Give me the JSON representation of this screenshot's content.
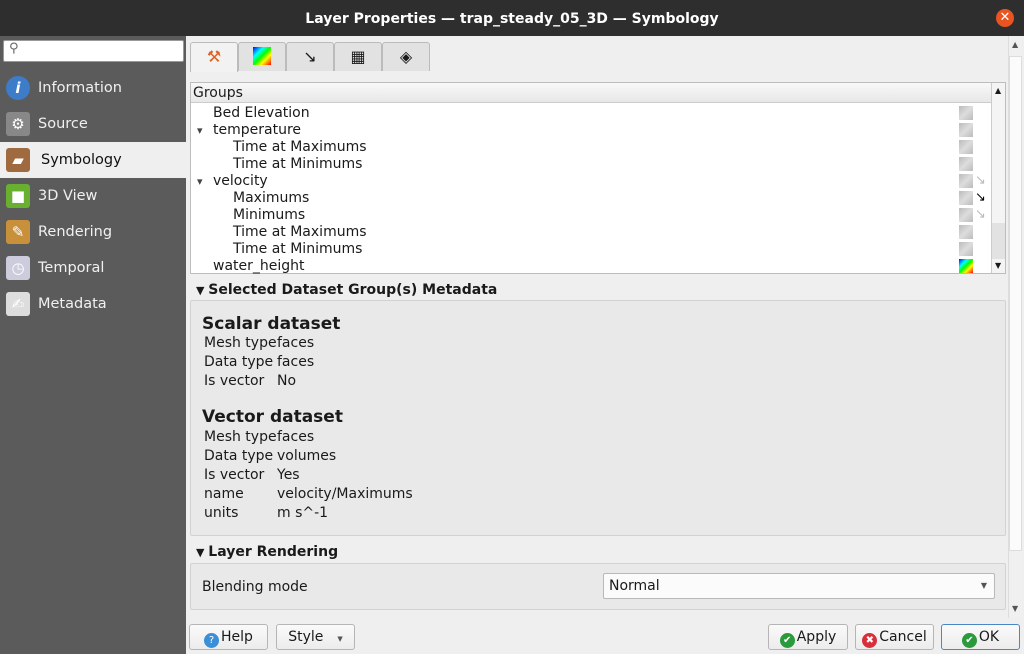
{
  "window": {
    "title": "Layer Properties — trap_steady_05_3D — Symbology",
    "close_icon": "close-icon",
    "accent": "#e95420"
  },
  "sidebar": {
    "search_placeholder": "",
    "items": [
      {
        "label": "Information",
        "icon": "info-icon"
      },
      {
        "label": "Source",
        "icon": "source-icon"
      },
      {
        "label": "Symbology",
        "icon": "symbology-icon",
        "selected": true
      },
      {
        "label": "3D View",
        "icon": "cube-icon"
      },
      {
        "label": "Rendering",
        "icon": "brush-icon"
      },
      {
        "label": "Temporal",
        "icon": "clock-icon"
      },
      {
        "label": "Metadata",
        "icon": "metadata-icon"
      }
    ]
  },
  "tabs": [
    {
      "icon": "tools-icon",
      "selected": true
    },
    {
      "icon": "color-ramp-icon"
    },
    {
      "icon": "vector-arrow-icon"
    },
    {
      "icon": "mesh-grid-icon"
    },
    {
      "icon": "stack-icon"
    }
  ],
  "groups": {
    "header": "Groups",
    "rows": [
      {
        "label": "Bed Elevation",
        "level": 0
      },
      {
        "label": "temperature",
        "level": 0,
        "expanded": true
      },
      {
        "label": "Time at Maximums",
        "level": 1
      },
      {
        "label": "Time at Minimums",
        "level": 1
      },
      {
        "label": "velocity",
        "level": 0,
        "expanded": true,
        "vector": "inactive"
      },
      {
        "label": "Maximums",
        "level": 1,
        "vector": "active"
      },
      {
        "label": "Minimums",
        "level": 1,
        "vector": "inactive"
      },
      {
        "label": "Time at Maximums",
        "level": 1
      },
      {
        "label": "Time at Minimums",
        "level": 1
      },
      {
        "label": "water_height",
        "level": 0,
        "scalar_active": true
      }
    ]
  },
  "metadata": {
    "title": "Selected Dataset Group(s) Metadata",
    "scalar": {
      "title": "Scalar dataset",
      "fields": [
        [
          "Mesh type",
          "faces"
        ],
        [
          "Data type",
          "faces"
        ],
        [
          "Is vector",
          "No"
        ]
      ]
    },
    "vector": {
      "title": "Vector dataset",
      "fields": [
        [
          "Mesh type",
          "faces"
        ],
        [
          "Data type",
          "volumes"
        ],
        [
          "Is vector",
          "Yes"
        ],
        [
          "name",
          "velocity/Maximums"
        ],
        [
          "units",
          "m s^-1"
        ]
      ]
    }
  },
  "rendering": {
    "title": "Layer Rendering",
    "blending_label": "Blending mode",
    "blending_value": "Normal"
  },
  "buttons": {
    "help": "Help",
    "style": "Style",
    "apply": "Apply",
    "cancel": "Cancel",
    "ok": "OK"
  }
}
